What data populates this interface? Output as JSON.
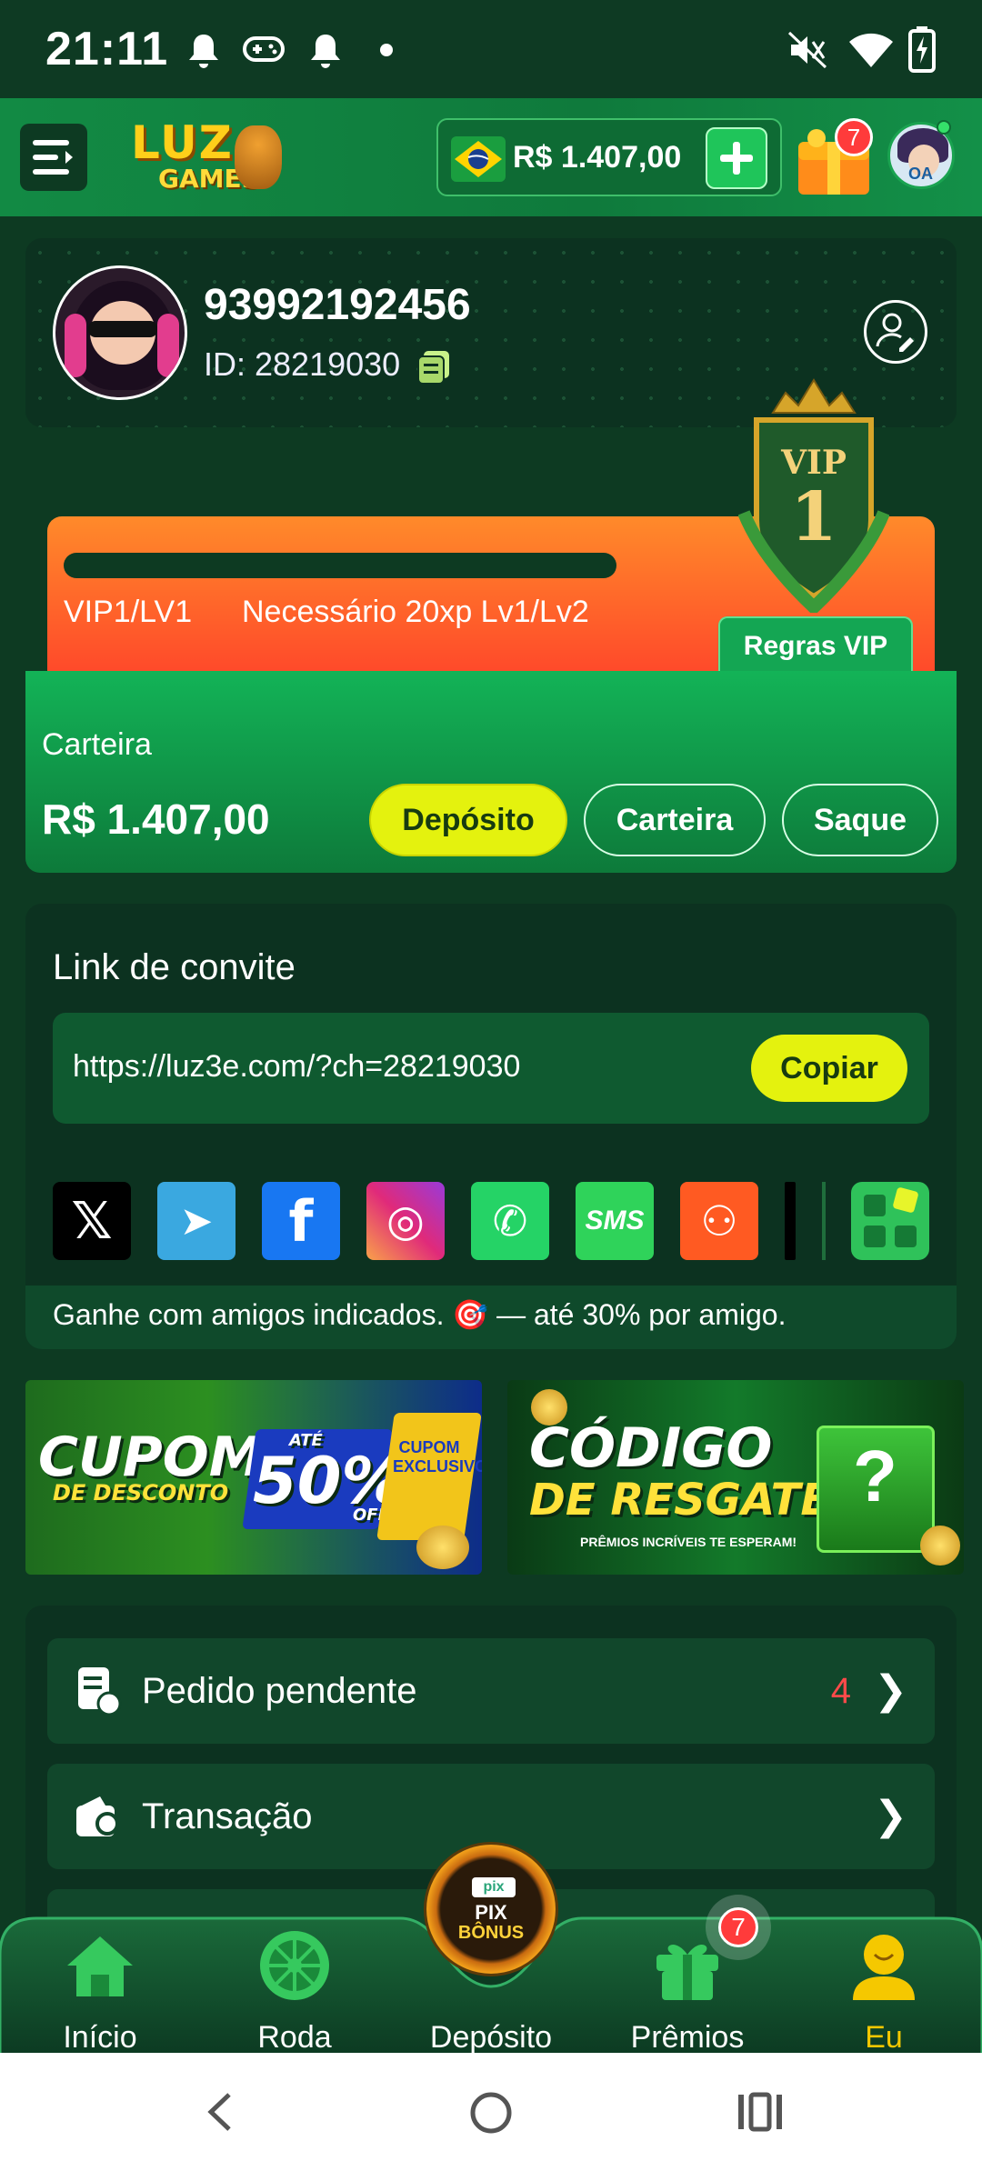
{
  "status_bar": {
    "time": "21:11"
  },
  "header": {
    "logo_line1": "LUZ",
    "logo_line2": "GAMES",
    "balance": "R$ 1.407,00",
    "gift_badge": "7",
    "avatar_initials": "OA"
  },
  "profile": {
    "name": "93992192456",
    "id_text": "ID: 28219030"
  },
  "vip": {
    "level_text": "VIP1/LV1",
    "requirement_text": "Necessário 20xp Lv1/Lv2",
    "rules_label": "Regras VIP",
    "badge_top": "VIP",
    "badge_level": "1",
    "progress": 0.0
  },
  "wallet": {
    "label": "Carteira",
    "amount": "R$ 1.407,00",
    "btn_deposit": "Depósito",
    "btn_wallet": "Carteira",
    "btn_withdraw": "Saque"
  },
  "invite": {
    "title": "Link de convite",
    "url": "https://luz3e.com/?ch=28219030",
    "copy_label": "Copiar",
    "note": "Ganhe com amigos indicados. 🎯 — até 30% por amigo.",
    "share": {
      "x": "𝕏",
      "telegram": "➤",
      "facebook": "f",
      "instagram": "◎",
      "whatsapp": "✆",
      "sms": "SMS",
      "other": "⚇"
    }
  },
  "banners": {
    "cupom_line1": "CUPOM",
    "cupom_line2": "DE DESCONTO",
    "cupom_percent": "50%",
    "cupom_until": "ATÉ",
    "cupom_off": "OFF",
    "cupom_excl": "CUPOM EXCLUSIVO",
    "codigo_line1": "CÓDIGO",
    "codigo_line2": "DE RESGATE",
    "codigo_sub": "PRÊMIOS INCRÍVEIS TE ESPERAM!"
  },
  "menu": {
    "pending_label": "Pedido pendente",
    "pending_count": "4",
    "transaction_label": "Transação"
  },
  "bottom_nav": {
    "home": "Início",
    "wheel": "Roda",
    "deposit": "Depósito",
    "prizes": "Prêmios",
    "prizes_badge": "7",
    "me": "Eu",
    "center_pix": "PIX",
    "center_bonus": "BÔNUS",
    "center_pix_small": "pix"
  },
  "colors": {
    "accent_yellow": "#e4f20e",
    "brand_green": "#13b357",
    "active_nav": "#f5c800",
    "alert_red": "#ff4a4a"
  }
}
